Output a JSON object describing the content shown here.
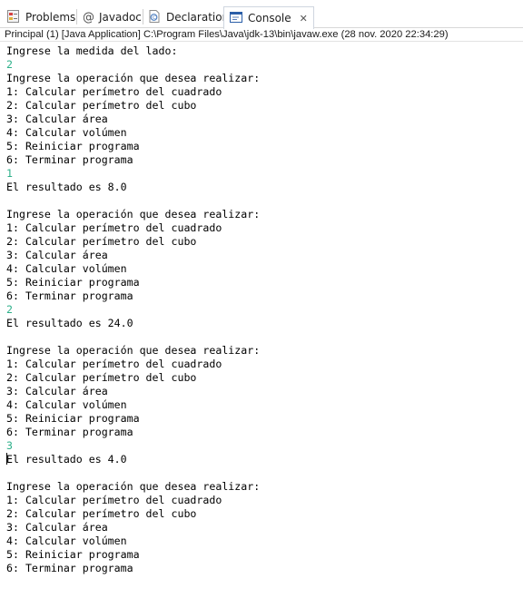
{
  "tabs": [
    {
      "label": "Problems",
      "icon": "problems-icon",
      "active": false
    },
    {
      "label": "Javadoc",
      "icon": "javadoc-at-icon",
      "active": false
    },
    {
      "label": "Declaration",
      "icon": "declaration-icon",
      "active": false
    },
    {
      "label": "Console",
      "icon": "console-icon",
      "active": true,
      "close": "✕"
    }
  ],
  "header_text": "Principal (1) [Java Application] C:\\Program Files\\Java\\jdk-13\\bin\\javaw.exe  (28 nov. 2020 22:34:29)",
  "colors": {
    "input_text": "#2eb08a",
    "output_text": "#000000"
  },
  "console_lines": [
    {
      "text": "Ingrese la medida del lado:",
      "type": "output"
    },
    {
      "text": "2",
      "type": "input"
    },
    {
      "text": "Ingrese la operación que desea realizar:",
      "type": "output"
    },
    {
      "text": "1: Calcular perímetro del cuadrado",
      "type": "output"
    },
    {
      "text": "2: Calcular perímetro del cubo",
      "type": "output"
    },
    {
      "text": "3: Calcular área",
      "type": "output"
    },
    {
      "text": "4: Calcular volúmen",
      "type": "output"
    },
    {
      "text": "5: Reiniciar programa",
      "type": "output"
    },
    {
      "text": "6: Terminar programa",
      "type": "output"
    },
    {
      "text": "1",
      "type": "input"
    },
    {
      "text": "El resultado es 8.0",
      "type": "output"
    },
    {
      "text": "",
      "type": "output"
    },
    {
      "text": "Ingrese la operación que desea realizar:",
      "type": "output"
    },
    {
      "text": "1: Calcular perímetro del cuadrado",
      "type": "output"
    },
    {
      "text": "2: Calcular perímetro del cubo",
      "type": "output"
    },
    {
      "text": "3: Calcular área",
      "type": "output"
    },
    {
      "text": "4: Calcular volúmen",
      "type": "output"
    },
    {
      "text": "5: Reiniciar programa",
      "type": "output"
    },
    {
      "text": "6: Terminar programa",
      "type": "output"
    },
    {
      "text": "2",
      "type": "input"
    },
    {
      "text": "El resultado es 24.0",
      "type": "output"
    },
    {
      "text": "",
      "type": "output"
    },
    {
      "text": "Ingrese la operación que desea realizar:",
      "type": "output"
    },
    {
      "text": "1: Calcular perímetro del cuadrado",
      "type": "output"
    },
    {
      "text": "2: Calcular perímetro del cubo",
      "type": "output"
    },
    {
      "text": "3: Calcular área",
      "type": "output"
    },
    {
      "text": "4: Calcular volúmen",
      "type": "output"
    },
    {
      "text": "5: Reiniciar programa",
      "type": "output"
    },
    {
      "text": "6: Terminar programa",
      "type": "output"
    },
    {
      "text": "3",
      "type": "input"
    },
    {
      "text": "El resultado es 4.0",
      "type": "output"
    },
    {
      "text": "",
      "type": "output"
    },
    {
      "text": "Ingrese la operación que desea realizar:",
      "type": "output"
    },
    {
      "text": "1: Calcular perímetro del cuadrado",
      "type": "output"
    },
    {
      "text": "2: Calcular perímetro del cubo",
      "type": "output"
    },
    {
      "text": "3: Calcular área",
      "type": "output"
    },
    {
      "text": "4: Calcular volúmen",
      "type": "output"
    },
    {
      "text": "5: Reiniciar programa",
      "type": "output"
    },
    {
      "text": "6: Terminar programa",
      "type": "output"
    }
  ]
}
